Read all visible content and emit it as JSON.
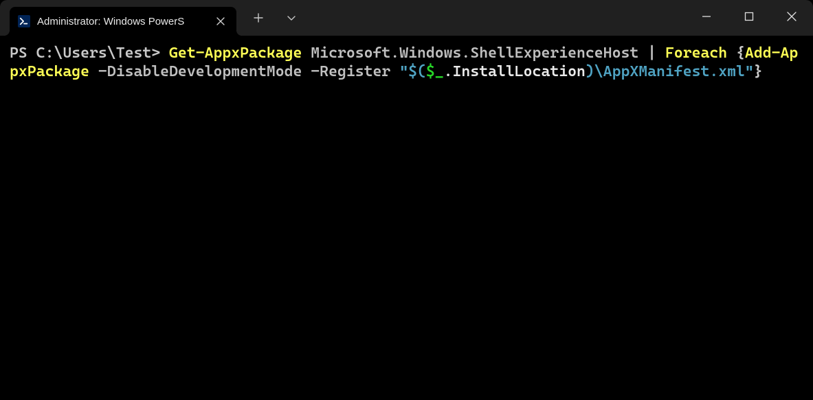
{
  "titlebar": {
    "tab": {
      "icon": "powershell-icon",
      "title": "Administrator: Windows PowerS",
      "close_label": "Close"
    },
    "new_tab_label": "New tab",
    "dropdown_label": "New tab dropdown",
    "minimize_label": "Minimize",
    "maximize_label": "Maximize",
    "close_label": "Close window"
  },
  "terminal": {
    "segments": [
      {
        "cls": "t-prompt",
        "text": "PS C:\\Users\\Test> "
      },
      {
        "cls": "t-cmd",
        "text": "Get-AppxPackage"
      },
      {
        "cls": "t-arg",
        "text": " Microsoft.Windows.ShellExperienceHost "
      },
      {
        "cls": "t-pipe",
        "text": "| "
      },
      {
        "cls": "t-cmd",
        "text": "Foreach"
      },
      {
        "cls": "t-brace",
        "text": " {"
      },
      {
        "cls": "t-cmd",
        "text": "Add-AppxPackage"
      },
      {
        "cls": "t-arg",
        "text": " -DisableDevelopmentMode -Register "
      },
      {
        "cls": "t-str",
        "text": "\"$("
      },
      {
        "cls": "t-var",
        "text": "$_"
      },
      {
        "cls": "t-member",
        "text": ".InstallLocation"
      },
      {
        "cls": "t-str",
        "text": ")"
      },
      {
        "cls": "t-path",
        "text": "\\AppXManifest.xml"
      },
      {
        "cls": "t-str",
        "text": "\""
      },
      {
        "cls": "t-brace",
        "text": "}"
      }
    ]
  }
}
